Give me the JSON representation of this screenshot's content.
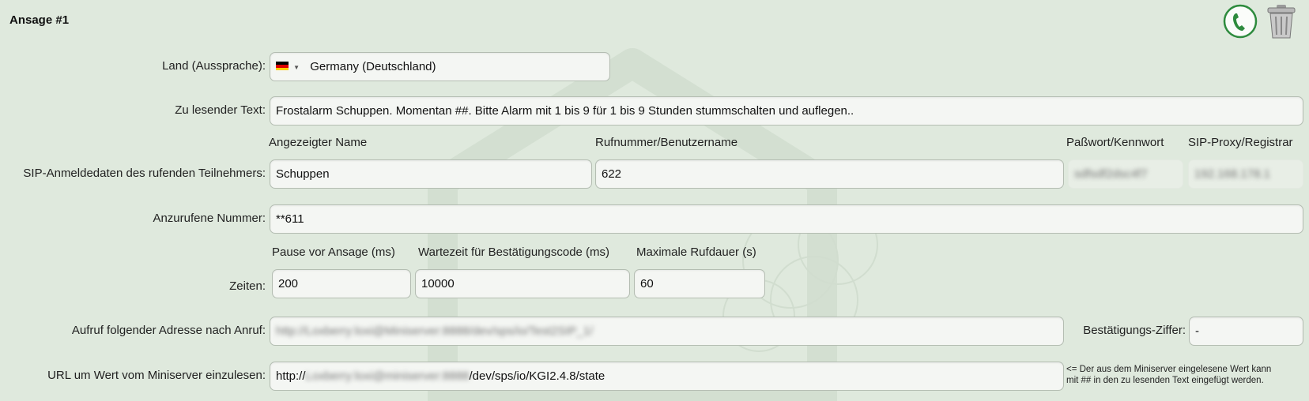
{
  "section": {
    "title": "Ansage #1"
  },
  "country": {
    "label": "Land (Aussprache):",
    "value": "Germany (Deutschland)"
  },
  "text": {
    "label": "Zu lesender Text:",
    "value": "Frostalarm Schuppen. Momentan ##. Bitte Alarm mit 1 bis 9 für 1 bis 9 Stunden stummschalten und auflegen.."
  },
  "sip": {
    "label": "SIP-Anmeldedaten des rufenden Teilnehmers:",
    "headers": {
      "display_name": "Angezeigter Name",
      "number": "Rufnummer/Benutzername",
      "password": "Paßwort/Kennwort",
      "proxy": "SIP-Proxy/Registrar"
    },
    "display_name": "Schuppen",
    "number": "622",
    "password": "sdfsdf2dsc4f7",
    "proxy": "192.168.178.1"
  },
  "call_number": {
    "label": "Anzurufene Nummer:",
    "value": "**611"
  },
  "times": {
    "label": "Zeiten:",
    "headers": {
      "pause": "Pause vor Ansage (ms)",
      "wait": "Wartezeit für Bestätigungscode (ms)",
      "max": "Maximale Rufdauer (s)"
    },
    "pause": "200",
    "wait": "10000",
    "max": "60"
  },
  "callback": {
    "label": "Aufruf folgender Adresse nach Anruf:",
    "value": "http://Loxberry:loxi@Miniserver:8888/dev/sps/io/Test2SIP_1/",
    "confirm_label": "Bestätigungs-Ziffer:",
    "confirm_value": "-"
  },
  "url": {
    "label": "URL um Wert vom Miniserver einzulesen:",
    "prefix": "http://",
    "hidden": "Loxberry:loxi@miniserver:8888",
    "suffix": "/dev/sps/io/KGI2.4.8/state",
    "note_line1": "<= Der aus dem Miniserver eingelesene Wert kann",
    "note_line2": "mit ## in den zu lesenden Text eingefügt werden."
  },
  "icons": {
    "call": "phone-icon",
    "delete": "trash-icon"
  },
  "colors": {
    "background": "#dfe9dd",
    "phone_green": "#2e8b3e"
  }
}
